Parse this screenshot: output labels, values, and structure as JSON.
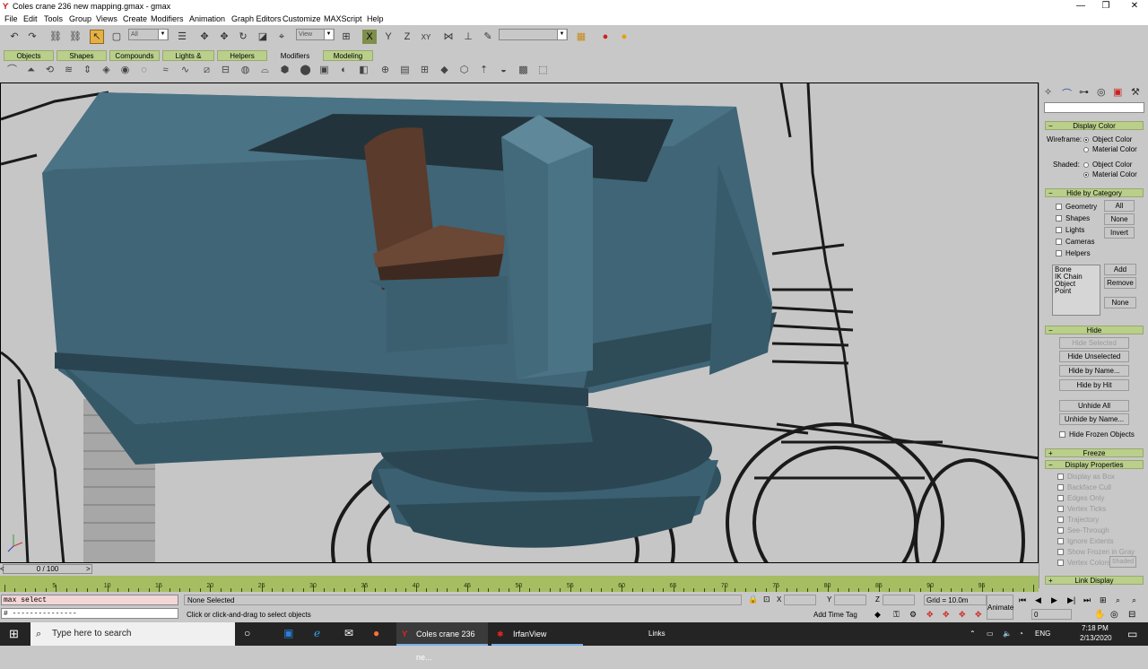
{
  "window": {
    "title": "Coles crane 236 new mapping.gmax - gmax",
    "minimize": "—",
    "restore": "❐",
    "close": "✕"
  },
  "menu": [
    "File",
    "Edit",
    "Tools",
    "Group",
    "Views",
    "Create",
    "Modifiers",
    "Animation",
    "Graph Editors",
    "Customize",
    "MAXScript",
    "Help"
  ],
  "toolbar": {
    "selection_filter": "All",
    "ref_coord": "View",
    "axis_x": "X",
    "axis_y": "Y",
    "axis_z": "Z",
    "axis_xy": "XY"
  },
  "tabs": [
    "Objects",
    "Shapes",
    "Compounds",
    "Lights & Cameras",
    "Helpers",
    "Modifiers",
    "Modeling"
  ],
  "active_tab": "Modifiers",
  "command_panel": {
    "display_color": {
      "header": "Display Color",
      "wireframe_label": "Wireframe:",
      "shaded_label": "Shaded:",
      "object_color": "Object Color",
      "material_color": "Material Color"
    },
    "hide_by_category": {
      "header": "Hide by Category",
      "items": [
        "Geometry",
        "Shapes",
        "Lights",
        "Cameras",
        "Helpers"
      ],
      "btn_all": "All",
      "btn_none": "None",
      "btn_invert": "Invert",
      "list_items": [
        "Bone",
        "IK Chain Object",
        "Point"
      ],
      "btn_add": "Add",
      "btn_remove": "Remove",
      "btn_none2": "None"
    },
    "hide": {
      "header": "Hide",
      "buttons": [
        "Hide Selected",
        "Hide Unselected",
        "Hide by Name...",
        "Hide by Hit",
        "Unhide All",
        "Unhide by Name..."
      ],
      "hide_frozen": "Hide Frozen Objects"
    },
    "freeze_header": "Freeze",
    "display_properties": {
      "header": "Display Properties",
      "items": [
        "Display as Box",
        "Backface Cull",
        "Edges Only",
        "Vertex Ticks",
        "Trajectory",
        "See-Through",
        "Ignore Extents",
        "Show Frozen in Gray",
        "Vertex Colors"
      ],
      "shaded_btn": "Shaded"
    },
    "link_display_header": "Link Display"
  },
  "timeline": {
    "slider": "0 / 100",
    "ticks": [
      "0",
      "5",
      "10",
      "15",
      "20",
      "25",
      "30",
      "35",
      "40",
      "45",
      "50",
      "55",
      "60",
      "65",
      "70",
      "75",
      "80",
      "85",
      "90",
      "95",
      "100"
    ]
  },
  "status": {
    "listener_cmd": "max select",
    "listener_out": "# ---------------",
    "selection": "None Selected",
    "prompt": "Click or click-and-drag to select objects",
    "x_label": "X",
    "y_label": "Y",
    "z_label": "Z",
    "grid": "Grid = 10.0m",
    "add_time_tag": "Add Time Tag",
    "animate": "Animate",
    "frame": "0"
  },
  "taskbar": {
    "search_placeholder": "Type here to search",
    "task_gmax": "Coles crane 236 ne...",
    "task_irfan": "IrfanView",
    "links": "Links",
    "lang": "ENG",
    "time": "7:18 PM",
    "date": "2/13/2020"
  },
  "colors": {
    "tab_green": "#b9cf8a",
    "ruler_green": "#a7bd62",
    "model_blue": "#3f6576",
    "seat_brown": "#5b3b2c"
  }
}
